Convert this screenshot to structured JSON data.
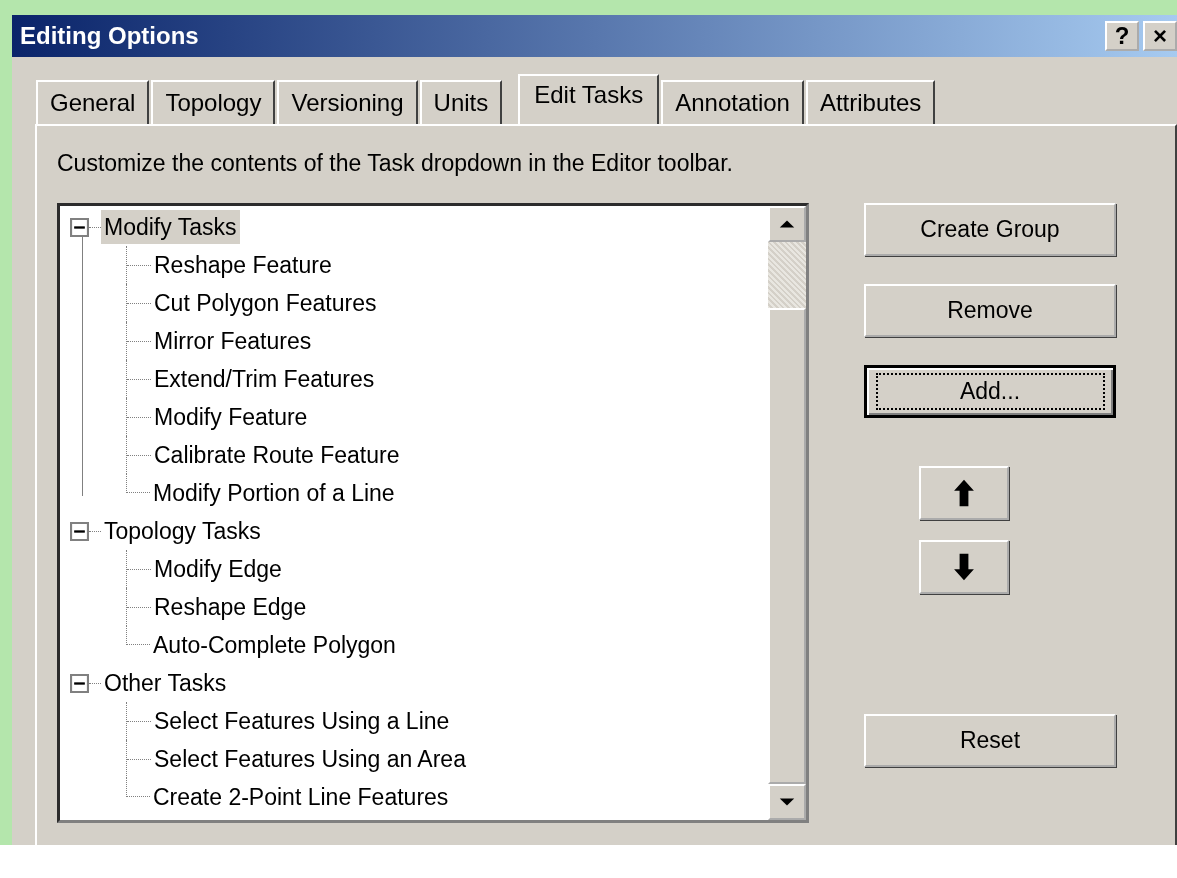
{
  "window": {
    "title": "Editing Options",
    "title_buttons": [
      "?",
      "×"
    ]
  },
  "tabs": [
    {
      "label": "General",
      "selected": false
    },
    {
      "label": "Topology",
      "selected": false
    },
    {
      "label": "Versioning",
      "selected": false
    },
    {
      "label": "Units",
      "selected": false
    },
    {
      "label": "Edit Tasks",
      "selected": true
    },
    {
      "label": "Annotation",
      "selected": false
    },
    {
      "label": "Attributes",
      "selected": false
    }
  ],
  "description": "Customize the contents of the Task dropdown in the Editor toolbar.",
  "task_tree": [
    {
      "label": "Modify Tasks",
      "expanded": true,
      "selected": true,
      "children": [
        {
          "label": "Reshape Feature",
          "selected": false
        },
        {
          "label": "Cut Polygon Features",
          "selected": false
        },
        {
          "label": "Mirror Features",
          "selected": false
        },
        {
          "label": "Extend/Trim Features",
          "selected": false
        },
        {
          "label": "Modify Feature",
          "selected": false
        },
        {
          "label": "Calibrate Route Feature",
          "selected": false
        },
        {
          "label": "Modify Portion of a Line",
          "selected": false
        }
      ]
    },
    {
      "label": "Topology Tasks",
      "expanded": true,
      "selected": false,
      "children": [
        {
          "label": "Modify Edge",
          "selected": false
        },
        {
          "label": "Reshape Edge",
          "selected": false
        },
        {
          "label": "Auto-Complete Polygon",
          "selected": false
        }
      ]
    },
    {
      "label": "Other Tasks",
      "expanded": true,
      "selected": false,
      "children": [
        {
          "label": "Select Features Using a Line",
          "selected": false
        },
        {
          "label": "Select Features Using an Area",
          "selected": false
        },
        {
          "label": "Create 2-Point Line Features",
          "selected": false
        }
      ]
    }
  ],
  "buttons": [
    {
      "label": "Create Group",
      "default": false
    },
    {
      "label": "Remove",
      "default": false
    },
    {
      "label": "Add...",
      "default": true
    }
  ],
  "reset_button": {
    "label": "Reset"
  }
}
